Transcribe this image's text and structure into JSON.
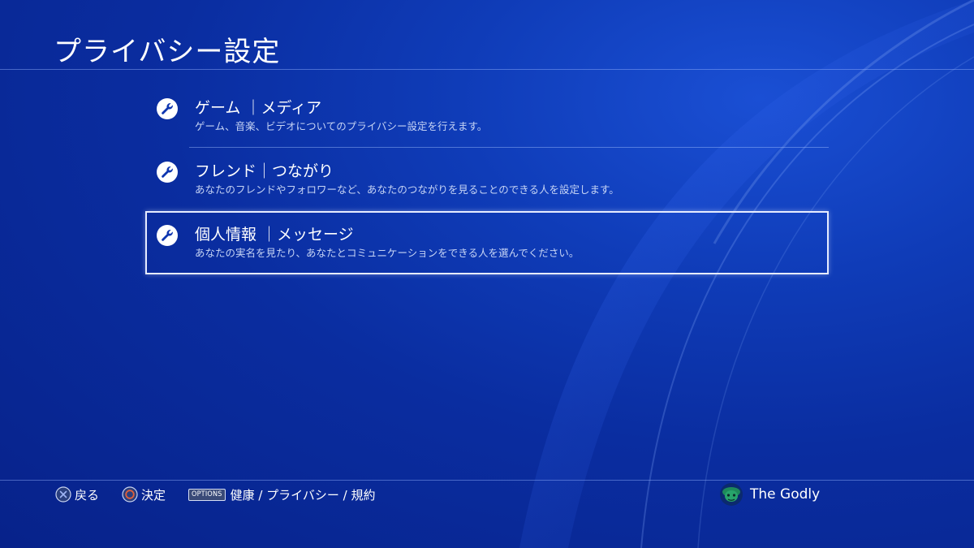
{
  "header": {
    "title": "プライバシー設定"
  },
  "menu": {
    "items": [
      {
        "icon": "wrench-icon",
        "title": "ゲーム ｜メディア",
        "description": "ゲーム、音楽、ビデオについてのプライバシー設定を行えます。",
        "selected": false
      },
      {
        "icon": "wrench-icon",
        "title": "フレンド｜つながり",
        "description": "あなたのフレンドやフォロワーなど、あなたのつながりを見ることのできる人を設定します。",
        "selected": false
      },
      {
        "icon": "wrench-icon",
        "title": "個人情報 ｜メッセージ",
        "description": "あなたの実名を見たり、あなたとコミュニケーションをできる人を選んでください。",
        "selected": true
      }
    ]
  },
  "footer": {
    "back": {
      "icon": "cross-button-icon",
      "label": "戻る"
    },
    "confirm": {
      "icon": "circle-button-icon",
      "label": "決定"
    },
    "options": {
      "badge": "OPTIONS",
      "label": "健康 / プライバシー / 規約"
    }
  },
  "user": {
    "name": "The Godly",
    "avatar_icon": "user-avatar-icon"
  },
  "colors": {
    "background": "#0a2da0",
    "highlight_border": "#e6ecff",
    "description_text": "#c6d4f5",
    "circle_button": "#e0603a",
    "avatar_green": "#1e8a5a"
  }
}
